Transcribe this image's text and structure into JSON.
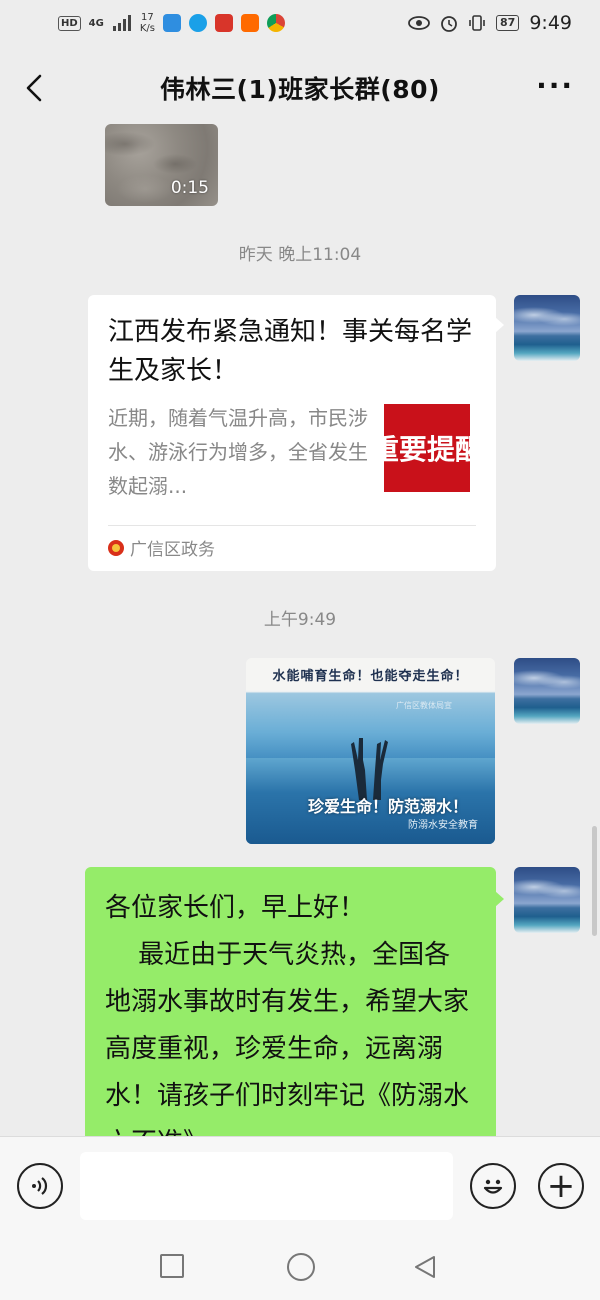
{
  "status_bar": {
    "hd": "HD",
    "signal": "4G",
    "net_speed_value": "17",
    "net_speed_unit": "K/s",
    "battery": "87",
    "time": "9:49"
  },
  "header": {
    "title": "伟林三(1)班家长群(80)",
    "more": "···"
  },
  "messages": {
    "video": {
      "duration": "0:15"
    },
    "timestamp_1": "昨天 晚上11:04",
    "link_card": {
      "title": "江西发布紧急通知！事关每名学生及家长！",
      "description": "近期，随着气温升高，市民涉水、游泳行为增多，全省发生数起溺...",
      "thumb_text": "重要提醒",
      "source": "广信区政务"
    },
    "timestamp_2": "上午9:49",
    "image": {
      "banner": "水能哺育生命！也能夺走生命！",
      "watermark": "广信区教体局宣",
      "caption": "珍爱生命！防范溺水！",
      "subcaption": "防溺水安全教育"
    },
    "text": "各位家长们，早上好！\n    最近由于天气炎热，全国各地溺水事故时有发生，希望大家高度重视，珍爱生命，远离溺水！请孩子们时刻牢记《防溺水六不准》"
  },
  "input_bar": {
    "placeholder": "",
    "plus": "+"
  },
  "icons": {
    "back": "back-arrow-icon",
    "voice": "voice-icon",
    "emoji": "emoji-icon",
    "plus": "plus-icon"
  },
  "colors": {
    "background": "#ededed",
    "self_bubble": "#95ec69",
    "card_bg": "#ffffff",
    "card_thumb": "#c9111a"
  }
}
